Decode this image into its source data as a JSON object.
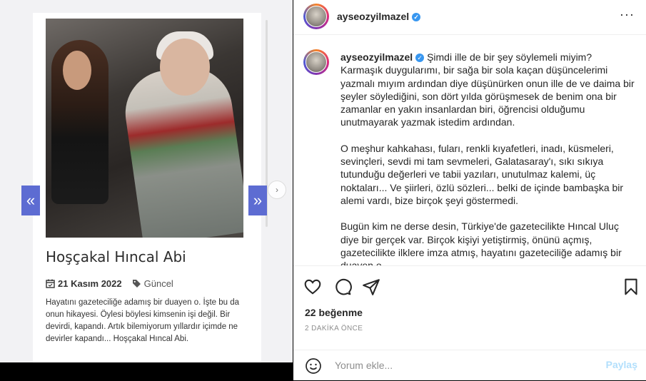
{
  "post_image": {
    "article_title": "Hoşçakal Hıncal Abi",
    "date": "21 Kasım 2022",
    "category": "Güncel",
    "excerpt": "Hayatını gazeteciliğe adamış bir duayen o. İşte bu da onun hikayesi. Öylesi böylesi kimsenin işi değil. Bir devirdi, kapandı. Artık bilemiyorum yıllardır içimde ne devirler kapandı... Hoşçakal Hıncal Abi.",
    "prev_glyph": "«",
    "next_glyph": "»",
    "carousel_next_glyph": "›"
  },
  "header": {
    "username": "ayseozyilmazel",
    "verified_glyph": "✓",
    "more_glyph": "···"
  },
  "caption": {
    "username": "ayseozyilmazel",
    "verified_glyph": "✓",
    "p1": "Şimdi ille de bir şey söylemeli miyim? Karmaşık duygularımı, bir sağa bir sola kaçan düşüncelerimi yazmalı mıyım ardından diye düşünürken onun ille de ve daima bir şeyler söylediğini, son dört yılda görüşmesek de benim ona bir zamanlar en yakın insanlardan biri, öğrencisi olduğumu unutmayarak yazmak istedim ardından.",
    "p2": "O meşhur kahkahası, fuları, renkli kıyafetleri, inadı, küsmeleri, sevinçleri, sevdi mi tam sevmeleri, Galatasaray'ı, sıkı sıkıya tutunduğu değerleri ve tabii yazıları, unutulmaz kalemi, üç noktaları... Ve şiirleri, özlü sözleri... belki de içinde bambaşka bir alemi vardı, bize birçok şeyi göstermedi.",
    "p3": "Bugün kim ne derse desin, Türkiye'de gazetecilikte Hıncal Uluç diye bir gerçek var. Birçok kişiyi yetiştirmiş, önünü açmış, gazetecilikte ilklere imza atmış, hayatını gazeteciliğe adamış bir duayen o."
  },
  "actions": {
    "icons": [
      "heart-icon",
      "comment-icon",
      "share-icon",
      "bookmark-icon"
    ]
  },
  "likes": "22 beğenme",
  "timestamp": "2 DAKİKA ÖNCE",
  "comment": {
    "placeholder": "Yorum ekle...",
    "share_label": "Paylaş"
  },
  "colors": {
    "verified": "#3897f0",
    "nav_button": "#5d6cd2",
    "share_disabled": "#b2dffc"
  }
}
